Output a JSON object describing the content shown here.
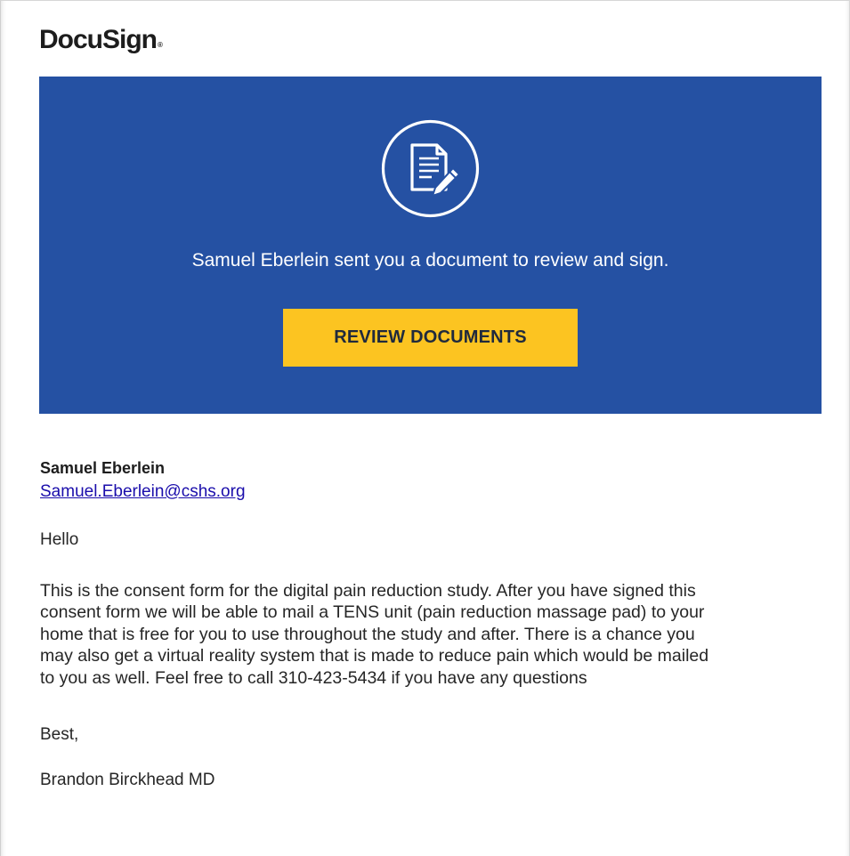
{
  "brand": {
    "logo_text": "DocuSign",
    "trademark": "®"
  },
  "banner": {
    "background_color": "#2551a3",
    "icon": "document-sign-icon",
    "message": "Samuel Eberlein sent you a document to review and sign.",
    "button_label": "REVIEW DOCUMENTS",
    "button_color": "#fcc421"
  },
  "sender": {
    "name": "Samuel Eberlein",
    "email": "Samuel.Eberlein@cshs.org"
  },
  "message": {
    "greeting": "Hello",
    "body_lines": [
      "This is the consent form for the digital pain reduction study. After you have signed this",
      "consent form we will be able to mail a TENS unit (pain reduction massage pad) to your",
      "home that is free for you to use throughout the study and after. There is a chance you",
      "may also get a virtual reality system that is made to reduce pain which would be mailed",
      "to you as well. Feel free to call 310-423-5434 if you have any questions"
    ],
    "signoff": "Best,",
    "signature": "Brandon Birckhead MD"
  }
}
